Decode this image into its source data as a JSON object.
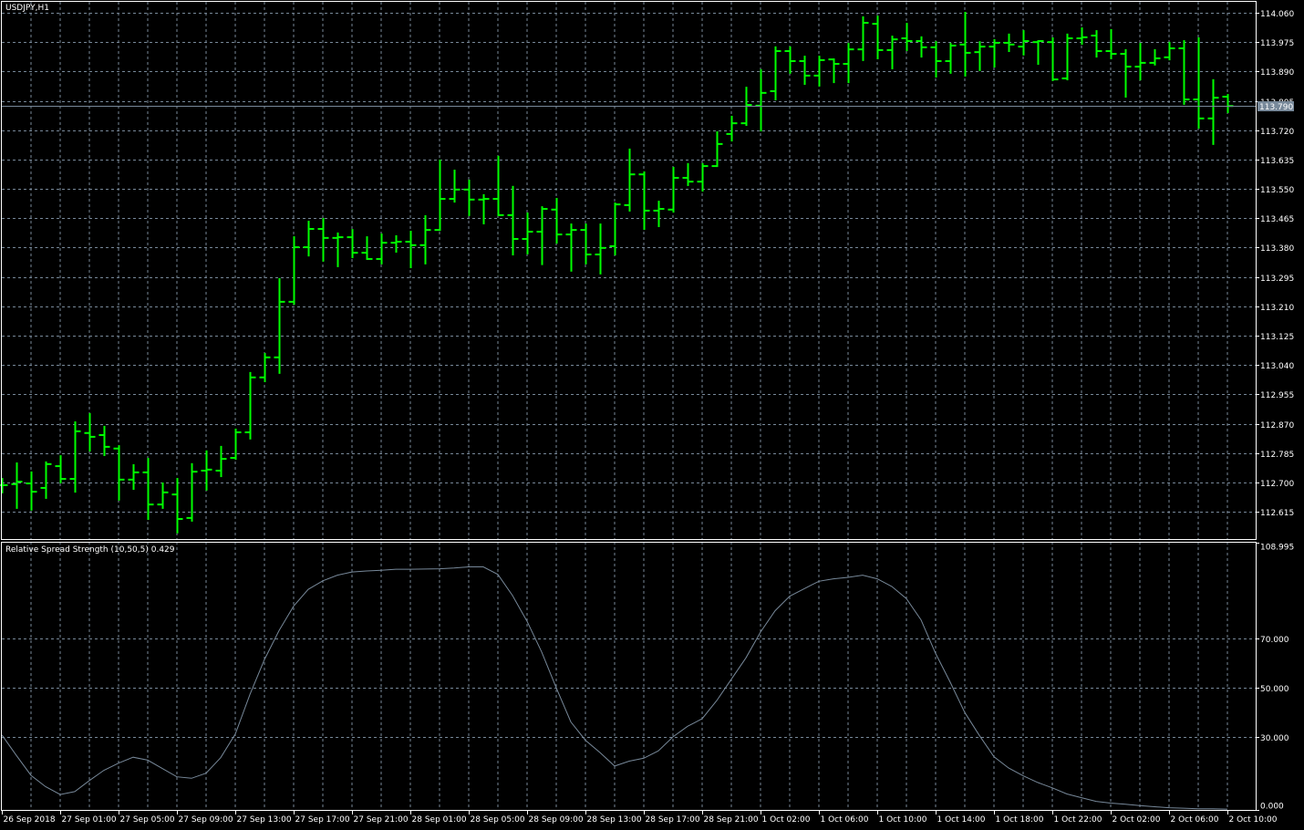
{
  "colors": {
    "background": "#000000",
    "bar": "#00ff00",
    "grid": "#778899",
    "frame": "#ffffff",
    "indicator_line": "#778899",
    "price_tag_bg": "#778899"
  },
  "chart_data": [
    {
      "type": "ohlc",
      "title": "USDJPY,H1",
      "current_price": "113.790",
      "ylim": [
        112.557,
        114.097
      ],
      "y_ticks": [
        "114.060",
        "113.975",
        "113.890",
        "113.805",
        "113.720",
        "113.635",
        "113.550",
        "113.465",
        "113.380",
        "113.295",
        "113.210",
        "113.125",
        "113.040",
        "112.955",
        "112.870",
        "112.785",
        "112.700",
        "112.615"
      ],
      "x_labels": [
        "26 Sep 2018",
        "27 Sep 01:00",
        "27 Sep 05:00",
        "27 Sep 09:00",
        "27 Sep 13:00",
        "27 Sep 17:00",
        "27 Sep 21:00",
        "28 Sep 01:00",
        "28 Sep 05:00",
        "28 Sep 09:00",
        "28 Sep 13:00",
        "28 Sep 17:00",
        "28 Sep 21:00",
        "1 Oct 02:00",
        "1 Oct 06:00",
        "1 Oct 10:00",
        "1 Oct 14:00",
        "1 Oct 18:00",
        "1 Oct 22:00",
        "2 Oct 02:00",
        "2 Oct 06:00",
        "2 Oct 10:00"
      ],
      "ohlc_fields": [
        "open",
        "high",
        "low",
        "close"
      ],
      "ohlc": [
        [
          112.692,
          112.71,
          112.671,
          112.692
        ],
        [
          112.695,
          112.755,
          112.626,
          112.702
        ],
        [
          112.697,
          112.729,
          112.621,
          112.673
        ],
        [
          112.684,
          112.758,
          112.655,
          112.753
        ],
        [
          112.747,
          112.776,
          112.7,
          112.71
        ],
        [
          112.71,
          112.874,
          112.673,
          112.848
        ],
        [
          112.843,
          112.898,
          112.792,
          112.832
        ],
        [
          112.837,
          112.861,
          112.779,
          112.803
        ],
        [
          112.798,
          112.805,
          112.65,
          112.708
        ],
        [
          112.708,
          112.75,
          112.681,
          112.729
        ],
        [
          112.729,
          112.768,
          112.594,
          112.636
        ],
        [
          112.636,
          112.697,
          112.626,
          112.671
        ],
        [
          112.665,
          112.71,
          112.555,
          112.594
        ],
        [
          112.597,
          112.753,
          112.589,
          112.731
        ],
        [
          112.734,
          112.79,
          112.679,
          112.737
        ],
        [
          112.734,
          112.803,
          112.718,
          112.768
        ],
        [
          112.771,
          112.853,
          112.768,
          112.845
        ],
        [
          112.845,
          113.017,
          112.827,
          113.004
        ],
        [
          113.004,
          113.072,
          112.993,
          113.062
        ],
        [
          113.062,
          113.289,
          113.017,
          113.223
        ],
        [
          113.223,
          113.41,
          113.217,
          113.381
        ],
        [
          113.381,
          113.455,
          113.357,
          113.434
        ],
        [
          113.434,
          113.463,
          113.342,
          113.408
        ],
        [
          113.408,
          113.421,
          113.326,
          113.41
        ],
        [
          113.41,
          113.431,
          113.352,
          113.365
        ],
        [
          113.365,
          113.41,
          113.347,
          113.347
        ],
        [
          113.347,
          113.418,
          113.334,
          113.394
        ],
        [
          113.394,
          113.413,
          113.368,
          113.397
        ],
        [
          113.397,
          113.426,
          113.323,
          113.387
        ],
        [
          113.387,
          113.471,
          113.334,
          113.431
        ],
        [
          113.431,
          113.632,
          113.431,
          113.521
        ],
        [
          113.521,
          113.603,
          113.513,
          113.548
        ],
        [
          113.548,
          113.574,
          113.474,
          113.519
        ],
        [
          113.519,
          113.532,
          113.45,
          113.521
        ],
        [
          113.521,
          113.643,
          113.474,
          113.474
        ],
        [
          113.474,
          113.556,
          113.36,
          113.405
        ],
        [
          113.405,
          113.479,
          113.363,
          113.426
        ],
        [
          113.426,
          113.497,
          113.332,
          113.492
        ],
        [
          113.49,
          113.521,
          113.394,
          113.418
        ],
        [
          113.418,
          113.447,
          113.313,
          113.431
        ],
        [
          113.431,
          113.447,
          113.334,
          113.36
        ],
        [
          113.36,
          113.447,
          113.305,
          113.379
        ],
        [
          113.384,
          113.508,
          113.36,
          113.505
        ],
        [
          113.503,
          113.664,
          113.487,
          113.592
        ],
        [
          113.592,
          113.598,
          113.434,
          113.487
        ],
        [
          113.487,
          113.513,
          113.442,
          113.492
        ],
        [
          113.49,
          113.611,
          113.484,
          113.582
        ],
        [
          113.582,
          113.622,
          113.561,
          113.571
        ],
        [
          113.571,
          113.622,
          113.545,
          113.616
        ],
        [
          113.616,
          113.714,
          113.616,
          113.68
        ],
        [
          113.709,
          113.759,
          113.69,
          113.74
        ],
        [
          113.74,
          113.843,
          113.735,
          113.793
        ],
        [
          113.791,
          113.894,
          113.719,
          113.828
        ],
        [
          113.833,
          113.96,
          113.809,
          113.949
        ],
        [
          113.949,
          113.96,
          113.886,
          113.92
        ],
        [
          113.92,
          113.933,
          113.854,
          113.878
        ],
        [
          113.878,
          113.933,
          113.849,
          113.923
        ],
        [
          113.925,
          113.925,
          113.859,
          113.912
        ],
        [
          113.912,
          113.97,
          113.859,
          113.954
        ],
        [
          113.954,
          114.047,
          113.923,
          114.031
        ],
        [
          114.028,
          114.049,
          113.928,
          113.952
        ],
        [
          113.952,
          113.991,
          113.899,
          113.983
        ],
        [
          113.986,
          114.028,
          113.952,
          113.978
        ],
        [
          113.978,
          113.989,
          113.933,
          113.96
        ],
        [
          113.96,
          113.975,
          113.875,
          113.92
        ],
        [
          113.92,
          113.97,
          113.886,
          113.965
        ],
        [
          113.968,
          114.06,
          113.878,
          113.944
        ],
        [
          113.946,
          113.975,
          113.894,
          113.962
        ],
        [
          113.962,
          113.981,
          113.904,
          113.973
        ],
        [
          113.973,
          113.997,
          113.949,
          113.968
        ],
        [
          113.962,
          114.007,
          113.939,
          113.978
        ],
        [
          113.975,
          113.978,
          113.912,
          113.978
        ],
        [
          113.975,
          113.986,
          113.865,
          113.867
        ],
        [
          113.87,
          113.997,
          113.867,
          113.986
        ],
        [
          113.986,
          114.015,
          113.97,
          113.989
        ],
        [
          113.994,
          114.007,
          113.933,
          113.949
        ],
        [
          113.949,
          114.01,
          113.928,
          113.941
        ],
        [
          113.941,
          113.952,
          113.817,
          113.904
        ],
        [
          113.904,
          113.97,
          113.867,
          113.915
        ],
        [
          113.915,
          113.952,
          113.91,
          113.928
        ],
        [
          113.931,
          113.973,
          113.925,
          113.957
        ],
        [
          113.957,
          113.978,
          113.796,
          113.809
        ],
        [
          113.809,
          113.986,
          113.727,
          113.754
        ],
        [
          113.754,
          113.865,
          113.68,
          113.814
        ],
        [
          113.817,
          113.822,
          113.772,
          113.79
        ]
      ]
    },
    {
      "type": "line",
      "title": "Relative Spread Strength (10,50,5) 0.429",
      "ylim": [
        0,
        108.995
      ],
      "y_ticks": [
        "108.995",
        "70.000",
        "50.000",
        "30.000",
        "0.000"
      ],
      "grid_levels": [
        70,
        50,
        30
      ],
      "values": [
        30.7,
        22.3,
        14.2,
        9.6,
        6.4,
        7.6,
        12.1,
        16.3,
        19.2,
        21.6,
        20.4,
        17.0,
        13.6,
        13.0,
        15.1,
        21.4,
        31.0,
        47.1,
        61.4,
        73.2,
        83.2,
        90.0,
        93.5,
        95.8,
        97.1,
        97.5,
        97.8,
        98.2,
        98.2,
        98.3,
        98.4,
        98.7,
        99.2,
        99.2,
        96.1,
        87.5,
        77.0,
        64.5,
        49.9,
        36.0,
        28.5,
        23.5,
        18.0,
        20.0,
        21.2,
        24.2,
        29.9,
        34.2,
        37.3,
        44.7,
        53.4,
        62.1,
        72.6,
        81.3,
        87.2,
        90.3,
        93.3,
        94.3,
        94.9,
        95.8,
        94.3,
        91.2,
        86.2,
        77.6,
        63.9,
        52.2,
        39.8,
        30.5,
        21.8,
        17.2,
        14.0,
        11.3,
        9.1,
        6.6,
        5.1,
        3.6,
        2.9,
        2.4,
        1.9,
        1.4,
        1.0,
        0.8,
        0.6,
        0.6,
        0.429
      ]
    }
  ]
}
